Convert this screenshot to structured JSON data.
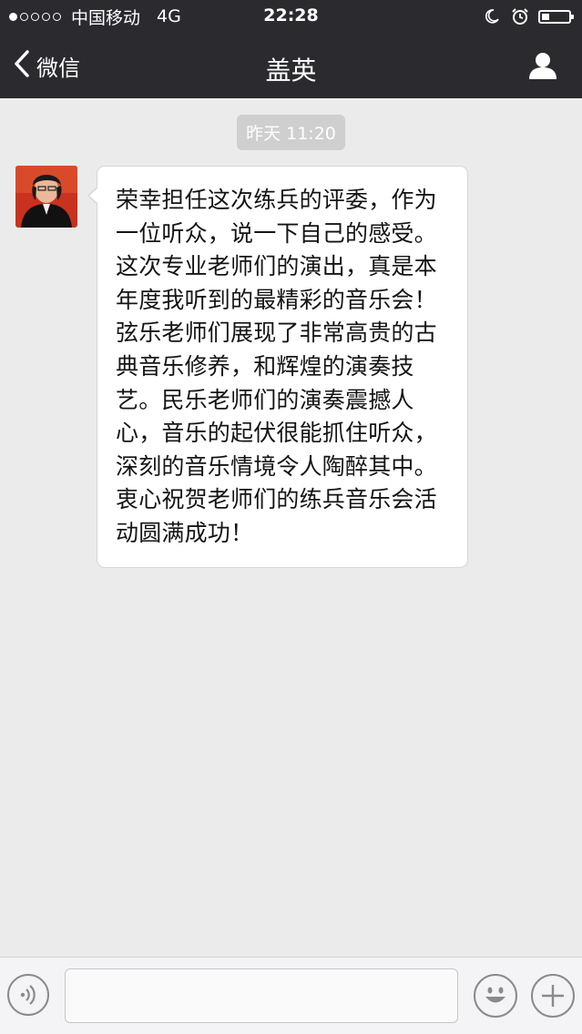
{
  "status_bar": {
    "carrier": "中国移动",
    "network": "4G",
    "time": "22:28",
    "signal_strength": 1,
    "signal_total": 5,
    "battery_level": 0.3,
    "icons": [
      "moon-icon",
      "alarm-icon",
      "battery-icon"
    ]
  },
  "nav": {
    "back_label": "微信",
    "title": "盖英",
    "back_icon": "chevron-left-icon",
    "profile_icon": "person-icon"
  },
  "chat": {
    "timestamp": "昨天 11:20",
    "messages": [
      {
        "sender": "contact",
        "text": "荣幸担任这次练兵的评委，作为一位听众，说一下自己的感受。这次专业老师们的演出，真是本年度我听到的最精彩的音乐会！弦乐老师们展现了非常高贵的古典音乐修养，和辉煌的演奏技艺。民乐老师们的演奏震撼人心，音乐的起伏很能抓住听众，深刻的音乐情境令人陶醉其中。衷心祝贺老师们的练兵音乐会活动圆满成功！"
      }
    ]
  },
  "input_bar": {
    "value": "",
    "placeholder": "",
    "voice_icon": "voice-icon",
    "emoji_icon": "emoji-icon",
    "plus_icon": "plus-icon"
  },
  "colors": {
    "header_bg": "#2b2b2f",
    "chat_bg": "#ebebeb",
    "bubble_bg": "#ffffff",
    "timestamp_bg": "#cfcfcf"
  }
}
